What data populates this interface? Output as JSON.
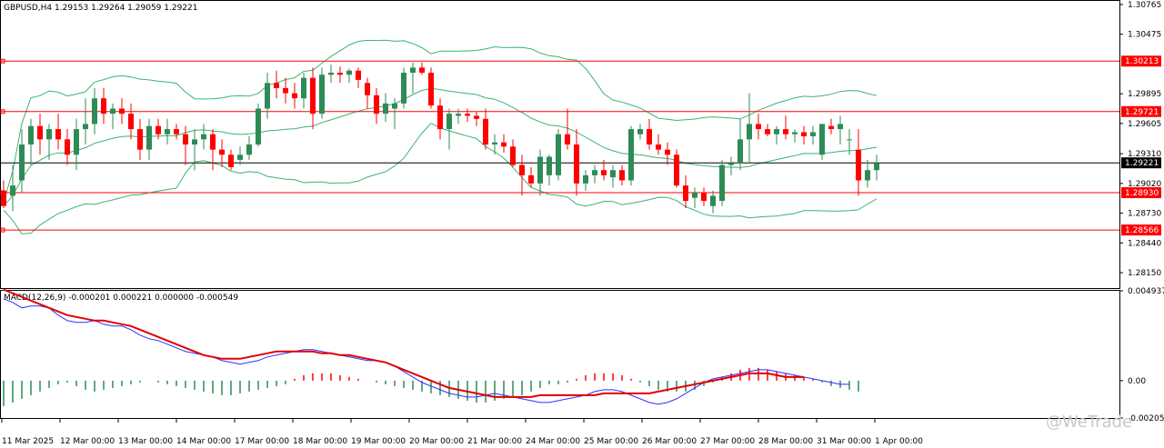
{
  "price_header": "GBPUSD,H4  1.29153 1.29264 1.29059 1.29221",
  "macd_header": "MACD(12,26,9) -0.000201 0.000221 0.000000 -0.000549",
  "watermark": "@WeTrade",
  "colors": {
    "bull": "#2e8b57",
    "bear": "#ff0000",
    "bands": "#3cb371",
    "hline": "#ff0000",
    "current_line": "#000000",
    "macd_signal": "#e00000",
    "macd_line": "#3030ff",
    "macd_hist_pos": "#ff0000",
    "macd_hist_neg": "#2e8b57",
    "axis": "#000000",
    "background": "#ffffff"
  },
  "chart_data": [
    {
      "type": "candlestick",
      "symbol": "GBPUSD",
      "timeframe": "H4",
      "ylim": [
        1.28,
        1.308
      ],
      "y_ticks": [
        "1.30765",
        "1.30475",
        "1.29895",
        "1.29605",
        "1.29310",
        "1.29020",
        "1.28730",
        "1.28440",
        "1.28150"
      ],
      "x_ticks": [
        "11 Mar 2025",
        "12 Mar 00:00",
        "13 Mar 00:00",
        "14 Mar 00:00",
        "17 Mar 00:00",
        "18 Mar 00:00",
        "19 Mar 00:00",
        "20 Mar 00:00",
        "21 Mar 00:00",
        "24 Mar 00:00",
        "25 Mar 00:00",
        "26 Mar 00:00",
        "27 Mar 00:00",
        "28 Mar 00:00",
        "31 Mar 00:00",
        "1 Apr 00:00"
      ],
      "horizontal_levels": [
        {
          "price": 1.30213,
          "label": "1.30213"
        },
        {
          "price": 1.29721,
          "label": "1.29721"
        },
        {
          "price": 1.2893,
          "label": "1.28930"
        },
        {
          "price": 1.28566,
          "label": "1.28566"
        }
      ],
      "current_price": {
        "price": 1.29221,
        "label": "1.29221"
      },
      "candles": [
        {
          "o": 1.2895,
          "h": 1.2905,
          "l": 1.2878,
          "c": 1.288
        },
        {
          "o": 1.289,
          "h": 1.292,
          "l": 1.2875,
          "c": 1.29
        },
        {
          "o": 1.2905,
          "h": 1.2955,
          "l": 1.2893,
          "c": 1.294
        },
        {
          "o": 1.294,
          "h": 1.2965,
          "l": 1.292,
          "c": 1.2958
        },
        {
          "o": 1.2958,
          "h": 1.297,
          "l": 1.293,
          "c": 1.2945
        },
        {
          "o": 1.2945,
          "h": 1.296,
          "l": 1.2925,
          "c": 1.2955
        },
        {
          "o": 1.2955,
          "h": 1.297,
          "l": 1.2935,
          "c": 1.2945
        },
        {
          "o": 1.2945,
          "h": 1.2955,
          "l": 1.292,
          "c": 1.293
        },
        {
          "o": 1.293,
          "h": 1.2965,
          "l": 1.2915,
          "c": 1.2955
        },
        {
          "o": 1.2955,
          "h": 1.2985,
          "l": 1.294,
          "c": 1.296
        },
        {
          "o": 1.296,
          "h": 1.2995,
          "l": 1.295,
          "c": 1.2985
        },
        {
          "o": 1.2985,
          "h": 1.2995,
          "l": 1.296,
          "c": 1.297
        },
        {
          "o": 1.297,
          "h": 1.298,
          "l": 1.2955,
          "c": 1.2975
        },
        {
          "o": 1.2975,
          "h": 1.2985,
          "l": 1.296,
          "c": 1.297
        },
        {
          "o": 1.297,
          "h": 1.298,
          "l": 1.2945,
          "c": 1.2955
        },
        {
          "o": 1.2955,
          "h": 1.2965,
          "l": 1.2925,
          "c": 1.2935
        },
        {
          "o": 1.2935,
          "h": 1.2965,
          "l": 1.2925,
          "c": 1.2958
        },
        {
          "o": 1.2958,
          "h": 1.2965,
          "l": 1.2945,
          "c": 1.295
        },
        {
          "o": 1.295,
          "h": 1.2965,
          "l": 1.294,
          "c": 1.2955
        },
        {
          "o": 1.2955,
          "h": 1.296,
          "l": 1.2945,
          "c": 1.295
        },
        {
          "o": 1.295,
          "h": 1.2958,
          "l": 1.292,
          "c": 1.294
        },
        {
          "o": 1.294,
          "h": 1.2955,
          "l": 1.2915,
          "c": 1.2945
        },
        {
          "o": 1.2945,
          "h": 1.296,
          "l": 1.2935,
          "c": 1.295
        },
        {
          "o": 1.295,
          "h": 1.2955,
          "l": 1.2915,
          "c": 1.2935
        },
        {
          "o": 1.2935,
          "h": 1.2945,
          "l": 1.2918,
          "c": 1.293
        },
        {
          "o": 1.293,
          "h": 1.2935,
          "l": 1.2915,
          "c": 1.2918
        },
        {
          "o": 1.2925,
          "h": 1.2938,
          "l": 1.292,
          "c": 1.293
        },
        {
          "o": 1.293,
          "h": 1.2948,
          "l": 1.2925,
          "c": 1.294
        },
        {
          "o": 1.294,
          "h": 1.298,
          "l": 1.2938,
          "c": 1.2975
        },
        {
          "o": 1.2975,
          "h": 1.301,
          "l": 1.2965,
          "c": 1.3
        },
        {
          "o": 1.3,
          "h": 1.3012,
          "l": 1.2985,
          "c": 1.2995
        },
        {
          "o": 1.2995,
          "h": 1.3005,
          "l": 1.298,
          "c": 1.299
        },
        {
          "o": 1.299,
          "h": 1.3,
          "l": 1.2975,
          "c": 1.2985
        },
        {
          "o": 1.2985,
          "h": 1.301,
          "l": 1.2975,
          "c": 1.3005
        },
        {
          "o": 1.3005,
          "h": 1.3015,
          "l": 1.2955,
          "c": 1.297
        },
        {
          "o": 1.297,
          "h": 1.3015,
          "l": 1.2965,
          "c": 1.3008
        },
        {
          "o": 1.3008,
          "h": 1.3018,
          "l": 1.3,
          "c": 1.301
        },
        {
          "o": 1.301,
          "h": 1.3016,
          "l": 1.3,
          "c": 1.3008
        },
        {
          "o": 1.3008,
          "h": 1.3014,
          "l": 1.3,
          "c": 1.3012
        },
        {
          "o": 1.3012,
          "h": 1.3015,
          "l": 1.2995,
          "c": 1.3003
        },
        {
          "o": 1.3,
          "h": 1.3005,
          "l": 1.2975,
          "c": 1.2988
        },
        {
          "o": 1.2988,
          "h": 1.2995,
          "l": 1.296,
          "c": 1.297
        },
        {
          "o": 1.297,
          "h": 1.299,
          "l": 1.2962,
          "c": 1.298
        },
        {
          "o": 1.2975,
          "h": 1.2985,
          "l": 1.2955,
          "c": 1.298
        },
        {
          "o": 1.298,
          "h": 1.3015,
          "l": 1.2975,
          "c": 1.301
        },
        {
          "o": 1.301,
          "h": 1.302,
          "l": 1.299,
          "c": 1.3015
        },
        {
          "o": 1.3015,
          "h": 1.302,
          "l": 1.3008,
          "c": 1.301
        },
        {
          "o": 1.301,
          "h": 1.3015,
          "l": 1.2975,
          "c": 1.2978
        },
        {
          "o": 1.2978,
          "h": 1.2985,
          "l": 1.2945,
          "c": 1.2955
        },
        {
          "o": 1.2955,
          "h": 1.2975,
          "l": 1.2935,
          "c": 1.297
        },
        {
          "o": 1.2968,
          "h": 1.2975,
          "l": 1.296,
          "c": 1.297
        },
        {
          "o": 1.297,
          "h": 1.2975,
          "l": 1.2962,
          "c": 1.2968
        },
        {
          "o": 1.2968,
          "h": 1.2972,
          "l": 1.2958,
          "c": 1.2965
        },
        {
          "o": 1.2965,
          "h": 1.2975,
          "l": 1.2935,
          "c": 1.294
        },
        {
          "o": 1.294,
          "h": 1.295,
          "l": 1.293,
          "c": 1.2942
        },
        {
          "o": 1.2942,
          "h": 1.295,
          "l": 1.2932,
          "c": 1.2938
        },
        {
          "o": 1.2938,
          "h": 1.2945,
          "l": 1.2918,
          "c": 1.292
        },
        {
          "o": 1.292,
          "h": 1.293,
          "l": 1.289,
          "c": 1.291
        },
        {
          "o": 1.291,
          "h": 1.2918,
          "l": 1.2898,
          "c": 1.2902
        },
        {
          "o": 1.2902,
          "h": 1.2935,
          "l": 1.289,
          "c": 1.2928
        },
        {
          "o": 1.291,
          "h": 1.293,
          "l": 1.29,
          "c": 1.2928
        },
        {
          "o": 1.291,
          "h": 1.2955,
          "l": 1.2905,
          "c": 1.295
        },
        {
          "o": 1.295,
          "h": 1.2975,
          "l": 1.2935,
          "c": 1.294
        },
        {
          "o": 1.294,
          "h": 1.2955,
          "l": 1.289,
          "c": 1.2902
        },
        {
          "o": 1.2902,
          "h": 1.2915,
          "l": 1.2895,
          "c": 1.291
        },
        {
          "o": 1.291,
          "h": 1.292,
          "l": 1.2902,
          "c": 1.2915
        },
        {
          "o": 1.2915,
          "h": 1.2925,
          "l": 1.2905,
          "c": 1.291
        },
        {
          "o": 1.2908,
          "h": 1.292,
          "l": 1.2898,
          "c": 1.2915
        },
        {
          "o": 1.2915,
          "h": 1.292,
          "l": 1.29,
          "c": 1.2905
        },
        {
          "o": 1.2905,
          "h": 1.2958,
          "l": 1.29,
          "c": 1.2955
        },
        {
          "o": 1.295,
          "h": 1.296,
          "l": 1.2945,
          "c": 1.2955
        },
        {
          "o": 1.2955,
          "h": 1.2965,
          "l": 1.2935,
          "c": 1.294
        },
        {
          "o": 1.294,
          "h": 1.295,
          "l": 1.293,
          "c": 1.2935
        },
        {
          "o": 1.2935,
          "h": 1.2942,
          "l": 1.292,
          "c": 1.293
        },
        {
          "o": 1.293,
          "h": 1.2935,
          "l": 1.2898,
          "c": 1.29
        },
        {
          "o": 1.29,
          "h": 1.291,
          "l": 1.2878,
          "c": 1.2885
        },
        {
          "o": 1.2888,
          "h": 1.2898,
          "l": 1.2878,
          "c": 1.2893
        },
        {
          "o": 1.2893,
          "h": 1.2898,
          "l": 1.288,
          "c": 1.2885
        },
        {
          "o": 1.288,
          "h": 1.2895,
          "l": 1.2873,
          "c": 1.289
        },
        {
          "o": 1.2885,
          "h": 1.2925,
          "l": 1.288,
          "c": 1.292
        },
        {
          "o": 1.292,
          "h": 1.2928,
          "l": 1.291,
          "c": 1.2922
        },
        {
          "o": 1.2922,
          "h": 1.2965,
          "l": 1.2915,
          "c": 1.2945
        },
        {
          "o": 1.2945,
          "h": 1.299,
          "l": 1.2922,
          "c": 1.296
        },
        {
          "o": 1.296,
          "h": 1.297,
          "l": 1.2945,
          "c": 1.2955
        },
        {
          "o": 1.2955,
          "h": 1.296,
          "l": 1.2948,
          "c": 1.295
        },
        {
          "o": 1.295,
          "h": 1.2958,
          "l": 1.294,
          "c": 1.2955
        },
        {
          "o": 1.2955,
          "h": 1.2968,
          "l": 1.2945,
          "c": 1.295
        },
        {
          "o": 1.295,
          "h": 1.2955,
          "l": 1.2942,
          "c": 1.2952
        },
        {
          "o": 1.2952,
          "h": 1.2958,
          "l": 1.294,
          "c": 1.2948
        },
        {
          "o": 1.2948,
          "h": 1.2958,
          "l": 1.294,
          "c": 1.2952
        },
        {
          "o": 1.293,
          "h": 1.296,
          "l": 1.2925,
          "c": 1.296
        },
        {
          "o": 1.2958,
          "h": 1.2965,
          "l": 1.295,
          "c": 1.2955
        },
        {
          "o": 1.2955,
          "h": 1.2968,
          "l": 1.294,
          "c": 1.296
        },
        {
          "o": 1.2945,
          "h": 1.2955,
          "l": 1.293,
          "c": 1.2945
        },
        {
          "o": 1.2935,
          "h": 1.2955,
          "l": 1.289,
          "c": 1.2905
        },
        {
          "o": 1.2905,
          "h": 1.2925,
          "l": 1.2898,
          "c": 1.2915
        },
        {
          "o": 1.2915,
          "h": 1.293,
          "l": 1.2905,
          "c": 1.2922
        }
      ]
    },
    {
      "type": "macd",
      "params": "MACD(12,26,9)",
      "values": {
        "macd": -0.000201,
        "signal": 0.000221,
        "hist": 0.0,
        "extra": -0.000549
      },
      "ylim": [
        -0.002054,
        0.004937
      ],
      "y_ticks": [
        "0.004937",
        "0.00",
        "-0.002054"
      ],
      "macd_line": [
        0.0045,
        0.0043,
        0.004,
        0.0041,
        0.0041,
        0.004,
        0.0036,
        0.0033,
        0.0032,
        0.0032,
        0.0033,
        0.0031,
        0.003,
        0.003,
        0.0028,
        0.0025,
        0.0023,
        0.0022,
        0.002,
        0.0018,
        0.0016,
        0.0015,
        0.0014,
        0.0013,
        0.0011,
        0.001,
        0.0009,
        0.001,
        0.0011,
        0.0013,
        0.0014,
        0.0015,
        0.0016,
        0.0017,
        0.0017,
        0.0016,
        0.0015,
        0.0014,
        0.0013,
        0.0012,
        0.0011,
        0.0011,
        0.001,
        0.0008,
        0.0005,
        0.0002,
        -0.0001,
        -0.0003,
        -0.0005,
        -0.0007,
        -0.0008,
        -0.0009,
        -0.0009,
        -0.0008,
        -0.0007,
        -0.0008,
        -0.0009,
        -0.001,
        -0.0011,
        -0.0012,
        -0.0012,
        -0.0011,
        -0.001,
        -0.0009,
        -0.0008,
        -0.0006,
        -0.0005,
        -0.0005,
        -0.0006,
        -0.0008,
        -0.001,
        -0.0012,
        -0.0013,
        -0.0012,
        -0.001,
        -0.0007,
        -0.0004,
        -0.0001,
        0.0001,
        0.0002,
        0.0003,
        0.0004,
        0.0005,
        0.0006,
        0.0006,
        0.0005,
        0.0004,
        0.0003,
        0.0002,
        0.0001,
        0.0,
        -0.0001,
        -0.0002,
        -0.0002
      ],
      "signal_line": [
        0.005,
        0.0048,
        0.0046,
        0.0044,
        0.0042,
        0.004,
        0.0038,
        0.0036,
        0.0035,
        0.0034,
        0.0033,
        0.0033,
        0.0032,
        0.0031,
        0.003,
        0.0028,
        0.0026,
        0.0024,
        0.0022,
        0.002,
        0.0018,
        0.0016,
        0.0014,
        0.0013,
        0.0012,
        0.0012,
        0.0012,
        0.0013,
        0.0014,
        0.0015,
        0.0016,
        0.0016,
        0.0016,
        0.0016,
        0.0016,
        0.0015,
        0.0015,
        0.0014,
        0.0014,
        0.0013,
        0.0012,
        0.0011,
        0.001,
        0.0008,
        0.0006,
        0.0004,
        0.0002,
        0.0,
        -0.0002,
        -0.0004,
        -0.0005,
        -0.0006,
        -0.0007,
        -0.0008,
        -0.0009,
        -0.0009,
        -0.0009,
        -0.0009,
        -0.0009,
        -0.0008,
        -0.0008,
        -0.0008,
        -0.0008,
        -0.0008,
        -0.0008,
        -0.0008,
        -0.0007,
        -0.0007,
        -0.0007,
        -0.0007,
        -0.0007,
        -0.0007,
        -0.0006,
        -0.0005,
        -0.0004,
        -0.0003,
        -0.0002,
        -0.0001,
        0.0,
        0.0001,
        0.0002,
        0.0003,
        0.0004,
        0.0004,
        0.0004,
        0.0003,
        0.0002,
        0.0002,
        0.0002
      ],
      "histogram": [
        -0.0014,
        -0.0012,
        -0.001,
        -0.0008,
        -0.0006,
        -0.0004,
        -0.0002,
        -0.0001,
        -0.0003,
        -0.0005,
        -0.0006,
        -0.0005,
        -0.0004,
        -0.0003,
        -0.0002,
        -0.0001,
        0.0,
        -0.0001,
        -0.0002,
        -0.0003,
        -0.0004,
        -0.0005,
        -0.0006,
        -0.0007,
        -0.0008,
        -0.0008,
        -0.0007,
        -0.0006,
        -0.0005,
        -0.0004,
        -0.0003,
        -0.0002,
        0.0001,
        0.0003,
        0.0004,
        0.0004,
        0.0004,
        0.0003,
        0.0002,
        0.0001,
        0.0,
        -0.0001,
        -0.0002,
        -0.0003,
        -0.0004,
        -0.0005,
        -0.0006,
        -0.0007,
        -0.0008,
        -0.0009,
        -0.001,
        -0.0011,
        -0.0012,
        -0.0012,
        -0.0011,
        -0.001,
        -0.0009,
        -0.0008,
        -0.0006,
        -0.0004,
        -0.0002,
        -0.0002,
        -0.0001,
        0.0001,
        0.0003,
        0.0004,
        0.0004,
        0.0004,
        0.0003,
        0.0001,
        -0.0001,
        -0.0003,
        -0.0005,
        -0.0006,
        -0.0006,
        -0.0006,
        -0.0005,
        -0.0003,
        -0.0001,
        0.0002,
        0.0004,
        0.0006,
        0.0007,
        0.0007,
        0.0006,
        0.0005,
        0.0004,
        0.0003,
        0.0002,
        0.0001,
        -0.0001,
        -0.0003,
        -0.0004,
        -0.0005,
        -0.0006
      ]
    }
  ]
}
